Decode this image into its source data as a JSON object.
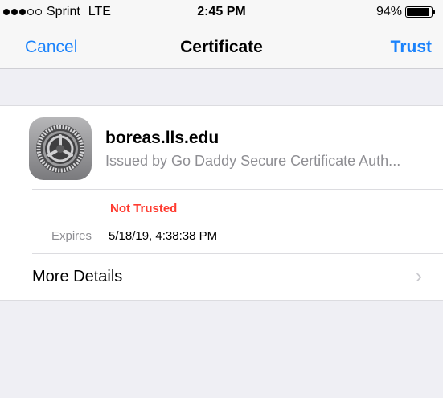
{
  "status_bar": {
    "signal_dots": [
      true,
      true,
      true,
      false,
      false
    ],
    "carrier": "Sprint",
    "network": "LTE",
    "time": "2:45 PM",
    "battery_percent": "94%",
    "battery_level": 0.94
  },
  "nav": {
    "cancel_label": "Cancel",
    "title": "Certificate",
    "trust_label": "Trust"
  },
  "certificate": {
    "icon": "settings-gear-icon",
    "name": "boreas.lls.edu",
    "issuer": "Issued by Go Daddy Secure Certificate Auth...",
    "trust_status": "Not Trusted",
    "expires_label": "Expires",
    "expires_value": "5/18/19, 4:38:38 PM",
    "more_details_label": "More Details"
  },
  "colors": {
    "accent": "#1a82fb",
    "warning": "#ff3b30",
    "background": "#efeff4"
  }
}
